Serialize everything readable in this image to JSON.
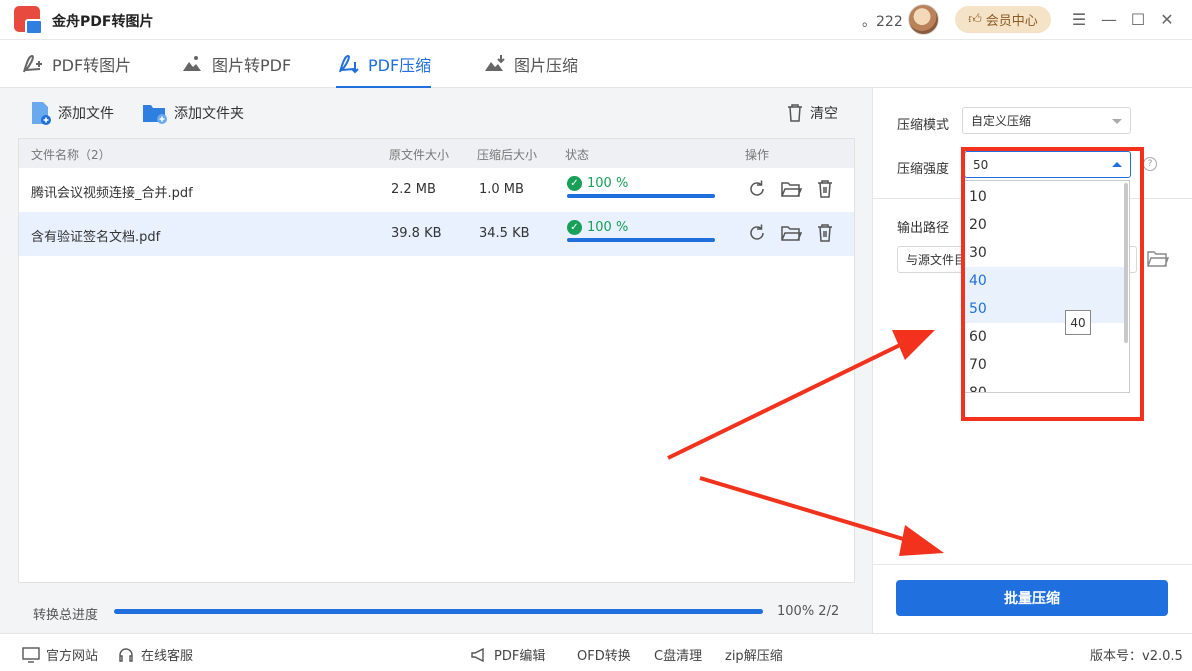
{
  "app": {
    "title": "金舟PDF转图片",
    "user_name": "。222",
    "vip_label": "会员中心"
  },
  "tabs": [
    {
      "label": "PDF转图片"
    },
    {
      "label": "图片转PDF"
    },
    {
      "label": "PDF压缩"
    },
    {
      "label": "图片压缩"
    }
  ],
  "toolbar": {
    "add_file": "添加文件",
    "add_folder": "添加文件夹",
    "clear": "清空"
  },
  "table": {
    "headers": {
      "name": "文件名称（2）",
      "orig_size": "原文件大小",
      "comp_size": "压缩后大小",
      "status": "状态",
      "ops": "操作"
    },
    "rows": [
      {
        "name": "腾讯会议视频连接_合并.pdf",
        "orig_size": "2.2 MB",
        "comp_size": "1.0 MB",
        "status": "100 %",
        "progress": 1.0
      },
      {
        "name": "含有验证签名文档.pdf",
        "orig_size": "39.8 KB",
        "comp_size": "34.5 KB",
        "status": "100 %",
        "progress": 1.0
      }
    ]
  },
  "progress": {
    "label": "转换总进度",
    "value_text": "100% 2/2",
    "fraction": 1.0
  },
  "panel": {
    "mode_label": "压缩模式",
    "mode_value": "自定义压缩",
    "strength_label": "压缩强度",
    "strength_value": "50",
    "output_label": "输出路径",
    "output_value": "与源文件目",
    "batch_button": "批量压缩"
  },
  "dropdown": {
    "options": [
      "10",
      "20",
      "30",
      "40",
      "50",
      "60",
      "70",
      "80"
    ],
    "hovered": "40",
    "selected": "50",
    "tooltip": "40"
  },
  "footer": {
    "website": "官方网站",
    "service": "在线客服",
    "pdf_edit": "PDF编辑",
    "ofd": "OFD转换",
    "c_clean": "C盘清理",
    "zip": "zip解压缩",
    "version": "版本号：v2.0.5"
  },
  "colors": {
    "accent": "#1f6fde",
    "success": "#18a058",
    "annotation": "#f2321c"
  }
}
